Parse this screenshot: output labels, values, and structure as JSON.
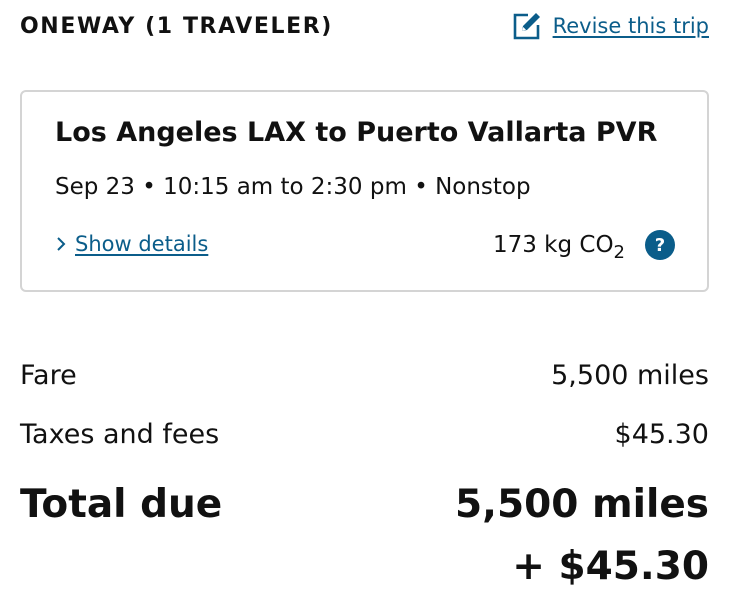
{
  "header": {
    "trip_type": "ONEWAY (1 TRAVELER)",
    "revise_label": "Revise this trip",
    "revise_icon": "edit-icon"
  },
  "flight": {
    "route": "Los Angeles LAX to Puerto Vallarta PVR",
    "schedule": "Sep 23 • 10:15 am to 2:30 pm • Nonstop",
    "details_label": "Show details",
    "emissions_value": "173 kg CO",
    "emissions_subscript": "2",
    "help_symbol": "?"
  },
  "pricing": {
    "fare_label": "Fare",
    "fare_value": "5,500 miles",
    "taxes_label": "Taxes and fees",
    "taxes_value": "$45.30",
    "total_label": "Total due",
    "total_miles": "5,500 miles",
    "total_cash": "+ $45.30"
  },
  "colors": {
    "link": "#0b5d8a",
    "text": "#111111",
    "card_border": "#d4d4d4"
  }
}
